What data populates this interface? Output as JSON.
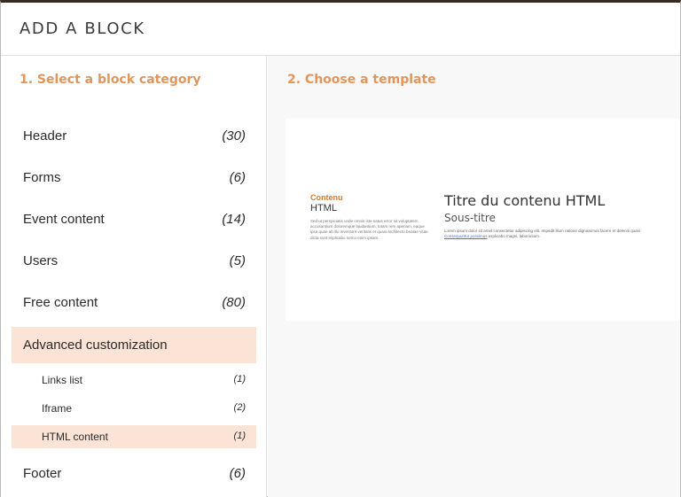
{
  "modal": {
    "title": "ADD A BLOCK"
  },
  "left": {
    "step_title": "1. Select a block category",
    "categories": [
      {
        "label": "Header",
        "count": "(30)"
      },
      {
        "label": "Forms",
        "count": "(6)"
      },
      {
        "label": "Event content",
        "count": "(14)"
      },
      {
        "label": "Users",
        "count": "(5)"
      },
      {
        "label": "Free content",
        "count": "(80)"
      },
      {
        "label": "Advanced customization",
        "count": ""
      },
      {
        "label": "Footer",
        "count": "(6)"
      }
    ],
    "subcategories": [
      {
        "label": "Links list",
        "count": "(1)"
      },
      {
        "label": "Iframe",
        "count": "(2)"
      },
      {
        "label": "HTML content",
        "count": "(1)"
      }
    ]
  },
  "right": {
    "step_title": "2. Choose a template",
    "template": {
      "kicker": "Contenu",
      "left_title": "HTML",
      "left_body": "Sed ut perspiciatis unde omnis iste natus error sit voluptatem accusantium doloremque laudantium, totam rem aperiam, eaque ipsa quae ab illo inventore veritatis et quasi architecto beatae vitae dicta sunt explicabo nemo enim ipsam.",
      "heading": "Titre du contenu HTML",
      "subheading": "Sous-titre",
      "text_before_link": "Lorem ipsum dolor sit amet consectetur adipiscing elit. Impedit illum ratione dignissimos facere et deleniti quasi ",
      "link_text": "Consequuntur possimus",
      "text_after_link": " explicabo magni, laboriosam."
    }
  }
}
